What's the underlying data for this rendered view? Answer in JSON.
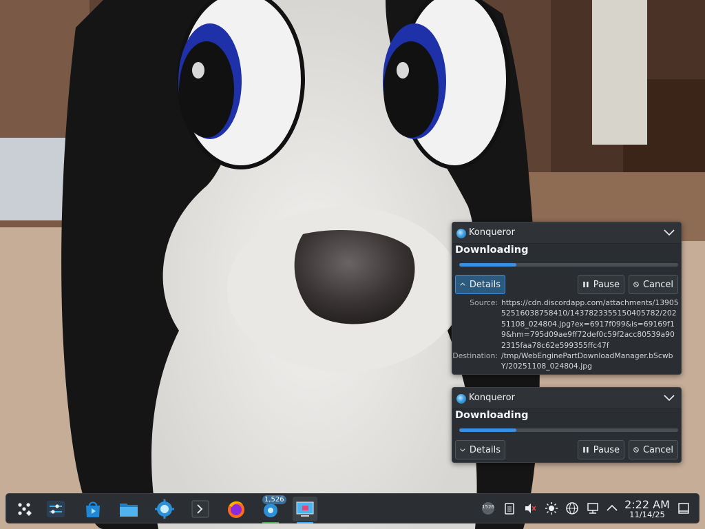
{
  "notifications": [
    {
      "app_name": "Konqueror",
      "title": "Downloading",
      "progress": 0.26,
      "details_label": "Details",
      "details_expanded": true,
      "pause_label": "Pause",
      "cancel_label": "Cancel",
      "source_key": "Source:",
      "source_value": "https://cdn.discordapp.com/attachments/1390552516038758410/1437823355150405782/20251108_024804.jpg?ex=6917f099&is=69169f19&hm=795d09ae9ff72def0c59f2acc80539a902315faa78c62e599355ffc47f",
      "destination_key": "Destination:",
      "destination_value": "/tmp/WebEnginePartDownloadManager.bScwbY/20251108_024804.jpg"
    },
    {
      "app_name": "Konqueror",
      "title": "Downloading",
      "progress": 0.26,
      "details_label": "Details",
      "details_expanded": false,
      "pause_label": "Pause",
      "cancel_label": "Cancel"
    }
  ],
  "taskbar": {
    "launchers": [
      "application-launcher-icon",
      "system-settings-icon",
      "discover-store-icon",
      "dolphin-file-manager-icon",
      "konqueror-icon",
      "konsole-terminal-icon",
      "firefox-icon",
      "update-manager-icon",
      "screenshot-tool-icon"
    ],
    "update_badge": "1,526",
    "tray_badge": "1526",
    "clock_time": "2:22 AM",
    "clock_date": "11/14/25"
  },
  "colors": {
    "accent": "#3d8ee0",
    "panel_bg": "#2a2e32",
    "taskbar_bg": "#2b2f33"
  }
}
